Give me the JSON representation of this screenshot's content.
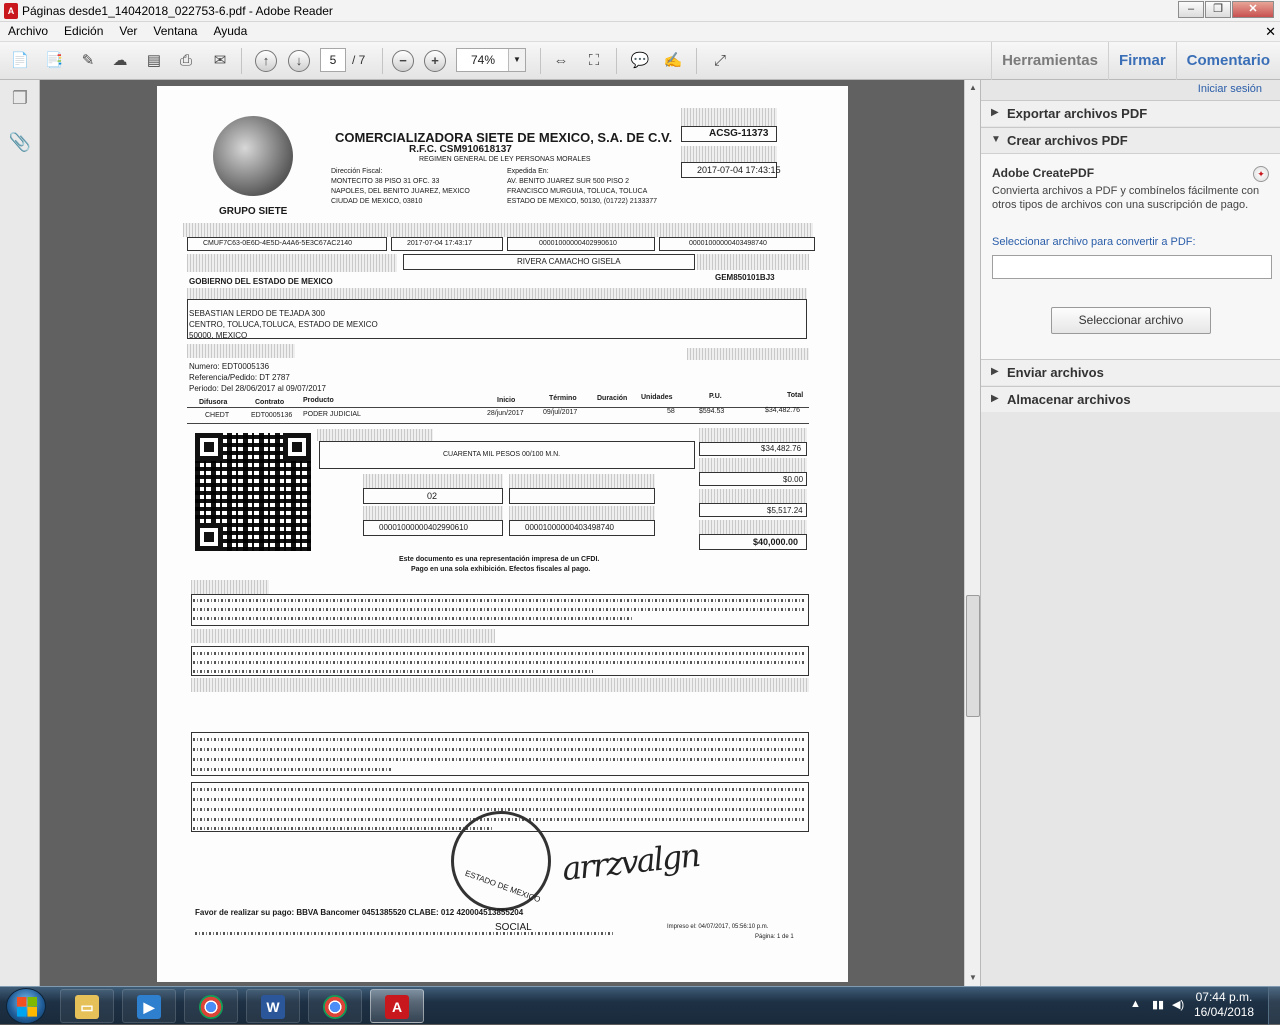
{
  "window": {
    "title": "Páginas desde1_14042018_022753-6.pdf - Adobe Reader",
    "controls": {
      "minimize": "–",
      "restore": "❐",
      "close": "✕"
    }
  },
  "menu": {
    "items": [
      "Archivo",
      "Edición",
      "Ver",
      "Ventana",
      "Ayuda"
    ],
    "close_glyph": "✕"
  },
  "toolbar": {
    "current_page": "5",
    "total_pages": "/ 7",
    "zoom": "74%",
    "zoom_out": "−",
    "zoom_in": "+",
    "right_links": [
      "Herramientas",
      "Firmar",
      "Comentario"
    ]
  },
  "side_panel": {
    "signin": "Iniciar sesión",
    "sections": {
      "export": "Exportar archivos PDF",
      "create": "Crear archivos PDF",
      "send": "Enviar archivos",
      "store": "Almacenar archivos"
    },
    "create_body": {
      "heading": "Adobe CreatePDF",
      "description": "Convierta archivos a PDF y combínelos fácilmente con otros tipos de archivos con una suscripción de pago.",
      "select_label": "Seleccionar archivo para convertir a PDF:",
      "select_button": "Seleccionar archivo"
    }
  },
  "document": {
    "company": "COMERCIALIZADORA SIETE DE MEXICO, S.A. DE C.V.",
    "rfc": "R.F.C. CSM910618137",
    "regimen": "REGIMEN GENERAL DE LEY PERSONAS MORALES",
    "logo_caption": "GRUPO SIETE",
    "folio": "ACSG-11373",
    "folio_date": "2017-07-04 17:43:15",
    "fiscal_label": "Dirección Fiscal:",
    "fiscal_lines": [
      "MONTECITO 38 PISO 31 OFC. 33",
      "NAPOLES, DEL BENITO JUAREZ, MEXICO",
      "CIUDAD DE MEXICO, 03810"
    ],
    "expedida_label": "Expedida En:",
    "expedida_lines": [
      "AV. BENITO JUAREZ SUR 500 PISO 2",
      "FRANCISCO MURGUIA, TOLUCA, TOLUCA",
      "ESTADO DE MEXICO, 50130, (01722) 2133377"
    ],
    "uuid": "CMUF7C63-0E6D-4E5D-A4A6-5E3C67AC2140",
    "timbre_date": "2017-07-04 17:43:17",
    "cert_1": "00001000000402990610",
    "cert_2": "00001000000403498740",
    "seller": "RIVERA CAMACHO GISELA",
    "client": "GOBIERNO DEL ESTADO DE MEXICO",
    "client_rfc": "GEM850101BJ3",
    "client_address": [
      "SEBASTIAN LERDO DE TEJADA 300",
      "CENTRO, TOLUCA,TOLUCA, ESTADO DE MEXICO",
      "50000, MEXICO"
    ],
    "numero": "Numero: EDT0005136",
    "referencia": "Referencia/Pedido: DT 2787",
    "periodo": "Periodo: Del 28/06/2017 al 09/07/2017",
    "cols": [
      "Difusora",
      "Contrato",
      "Producto",
      "Inicio",
      "Término",
      "Duración",
      "Unidades",
      "P.U.",
      "Total"
    ],
    "row": [
      "CHEDT",
      "EDT0005136",
      "PODER JUDICIAL",
      "28/jun/2017",
      "09/jul/2017",
      "",
      "58",
      "$594.53",
      "$34,482.76"
    ],
    "amount_words": "CUARENTA MIL PESOS 00/100 M.N.",
    "subtotal": "$34,482.76",
    "discount": "$0.00",
    "iva": "$5,517.24",
    "total": "$40,000.00",
    "pay_method": "02",
    "note_1": "Este documento es una representación impresa de un CFDI.",
    "note_2": "Pago en una sola exhibición. Efectos fiscales al pago.",
    "pay_line": "Favor de realizar su pago: BBVA Bancomer 0451385520 CLABE: 012 420004513855204",
    "printed": "Impreso el: 04/07/2017, 05:56:10 p.m.",
    "page_of": "Página: 1 de 1",
    "signature": "arrzvalgn",
    "seal_text": "ESTADO DE MEXICO",
    "footer_bottom": "SOCIAL"
  },
  "taskbar": {
    "time": "07:44 p.m.",
    "date": "16/04/2018",
    "lang": "▲"
  }
}
